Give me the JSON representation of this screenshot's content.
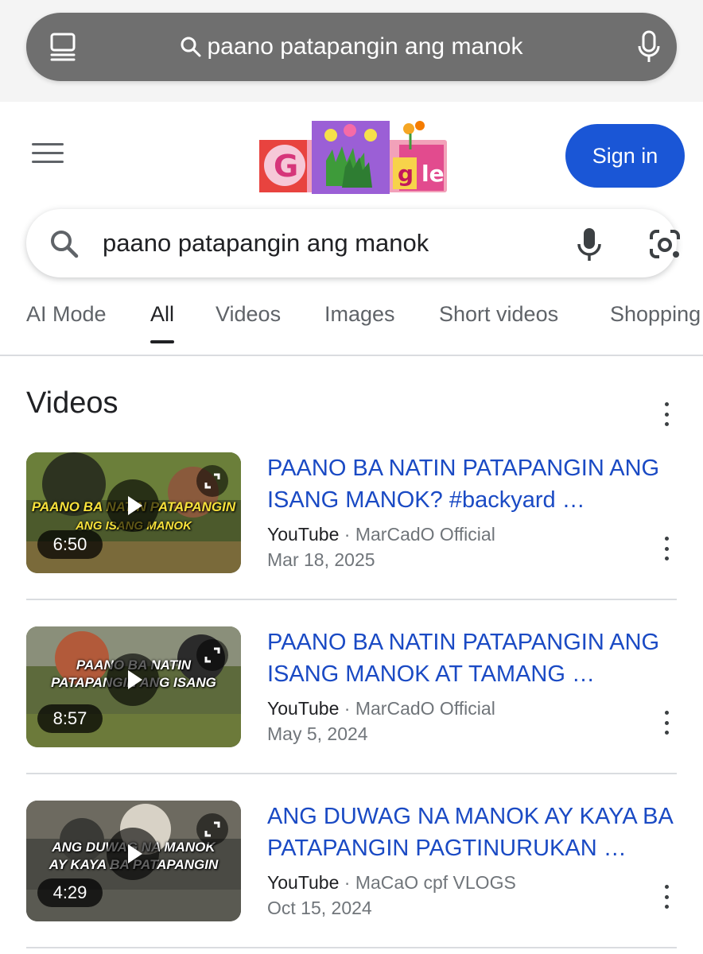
{
  "browser": {
    "address_text": "paano patapangin ang manok"
  },
  "header": {
    "sign_in_label": "Sign in"
  },
  "search": {
    "query": "paano patapangin ang manok"
  },
  "tabs": [
    {
      "label": "AI Mode",
      "active": false
    },
    {
      "label": "All",
      "active": true
    },
    {
      "label": "Videos",
      "active": false
    },
    {
      "label": "Images",
      "active": false
    },
    {
      "label": "Short videos",
      "active": false
    },
    {
      "label": "Shopping",
      "active": false
    }
  ],
  "videos": {
    "section_title": "Videos",
    "items": [
      {
        "title": "PAANO BA NATIN PATAPANGIN ANG ISANG MANOK? #backyard …",
        "source": "YouTube",
        "channel": "MarCadO Official",
        "date": "Mar 18, 2025",
        "duration": "6:50",
        "thumb_caption_1": "PAANO BA NATIN PATAPANGIN",
        "thumb_caption_2": "ANG ISANG MANOK"
      },
      {
        "title": "PAANO BA NATIN PATAPANGIN ANG ISANG MANOK AT TAMANG …",
        "source": "YouTube",
        "channel": "MarCadO Official",
        "date": "May 5, 2024",
        "duration": "8:57",
        "thumb_caption_1": "PAANO BA NATIN",
        "thumb_caption_2": "PATAPANGIN ANG ISANG"
      },
      {
        "title": "ANG DUWAG NA MANOK AY KAYA BA PATAPANGIN PAGTINURUKAN …",
        "source": "YouTube",
        "channel": "MaCaO cpf VLOGS",
        "date": "Oct 15, 2024",
        "duration": "4:29",
        "thumb_caption_1": "ANG DUWAG NA MANOK",
        "thumb_caption_2": "AY KAYA BA PATAPANGIN"
      }
    ]
  }
}
